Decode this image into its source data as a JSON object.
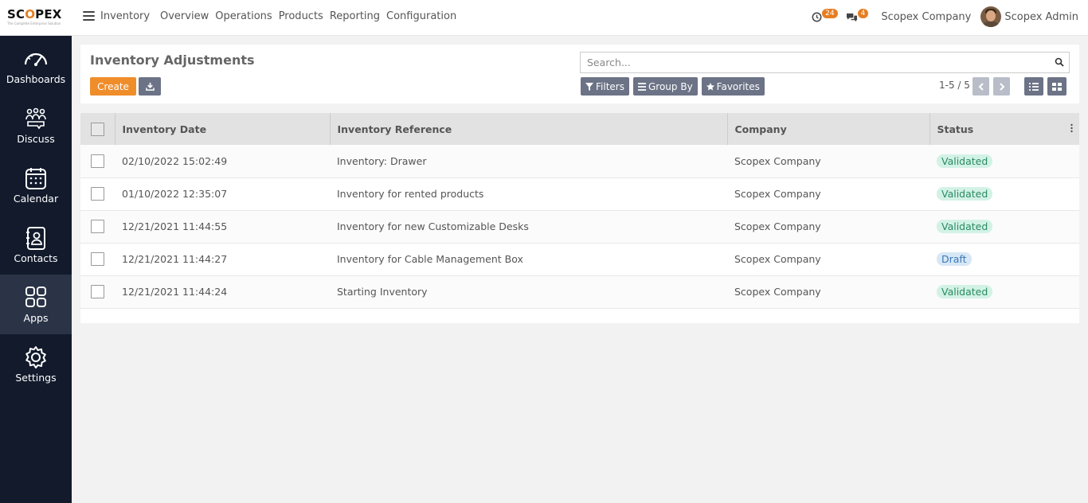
{
  "brand": {
    "name_prefix": "SC",
    "name_o": "O",
    "name_suffix": "PEX",
    "tagline": "The Complete Enterprise Solution"
  },
  "topbar": {
    "app_name": "Inventory",
    "menu": [
      "Overview",
      "Operations",
      "Products",
      "Reporting",
      "Configuration"
    ],
    "activity_count": "24",
    "messages_count": "4",
    "company": "Scopex Company",
    "user": "Scopex Admin"
  },
  "sidebar": {
    "items": [
      {
        "label": "Dashboards",
        "icon": "speedometer-icon"
      },
      {
        "label": "Discuss",
        "icon": "discuss-icon"
      },
      {
        "label": "Calendar",
        "icon": "calendar-icon"
      },
      {
        "label": "Contacts",
        "icon": "contacts-icon"
      },
      {
        "label": "Apps",
        "icon": "apps-grid-icon",
        "active": true
      },
      {
        "label": "Settings",
        "icon": "gear-icon"
      }
    ]
  },
  "control": {
    "title": "Inventory Adjustments",
    "create_label": "Create",
    "search_placeholder": "Search...",
    "filters_label": "Filters",
    "groupby_label": "Group By",
    "favorites_label": "Favorites",
    "pager": "1-5 / 5"
  },
  "table": {
    "columns": [
      "Inventory Date",
      "Inventory Reference",
      "Company",
      "Status"
    ],
    "rows": [
      {
        "date": "02/10/2022 15:02:49",
        "reference": "Inventory: Drawer",
        "company": "Scopex Company",
        "status": "Validated"
      },
      {
        "date": "01/10/2022 12:35:07",
        "reference": "Inventory for rented products",
        "company": "Scopex Company",
        "status": "Validated"
      },
      {
        "date": "12/21/2021 11:44:55",
        "reference": "Inventory for new Customizable Desks",
        "company": "Scopex Company",
        "status": "Validated"
      },
      {
        "date": "12/21/2021 11:44:27",
        "reference": "Inventory for Cable Management Box",
        "company": "Scopex Company",
        "status": "Draft"
      },
      {
        "date": "12/21/2021 11:44:24",
        "reference": "Starting Inventory",
        "company": "Scopex Company",
        "status": "Validated"
      }
    ]
  },
  "colors": {
    "accent": "#f08d2b",
    "sidebar": "#121a2c",
    "sidebar_active": "#2b3447",
    "button": "#6c7386",
    "validated_bg": "#d3f2e6",
    "draft_bg": "#d7e7f5"
  }
}
